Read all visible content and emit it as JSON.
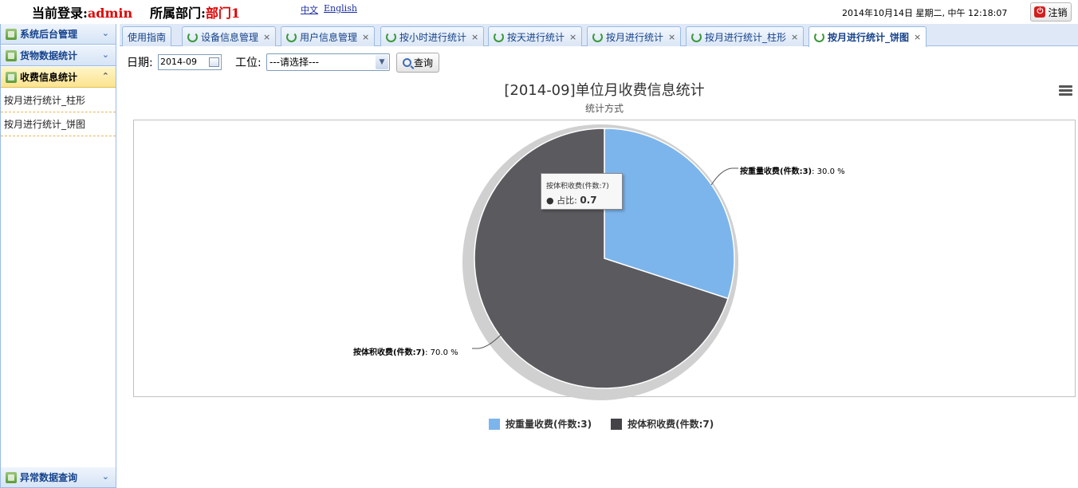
{
  "header": {
    "login_label": "当前登录:",
    "login_user": "admin",
    "dept_label": "所属部门:",
    "dept_value": "部门1",
    "lang_zh": "中文",
    "lang_en": "English",
    "datetime": "2014年10月14日 星期二, 中午 12:18:07",
    "logout_label": "注销"
  },
  "sidebar": {
    "sections": [
      {
        "label": "系统后台管理"
      },
      {
        "label": "货物数据统计"
      },
      {
        "label": "收费信息统计"
      },
      {
        "label": "异常数据查询"
      }
    ],
    "sub_items": [
      {
        "label": "按月进行统计_柱形"
      },
      {
        "label": "按月进行统计_饼图"
      }
    ]
  },
  "tabs": [
    {
      "label": "使用指南"
    },
    {
      "label": "设备信息管理"
    },
    {
      "label": "用户信息管理"
    },
    {
      "label": "按小时进行统计"
    },
    {
      "label": "按天进行统计"
    },
    {
      "label": "按月进行统计"
    },
    {
      "label": "按月进行统计_柱形"
    },
    {
      "label": "按月进行统计_饼图"
    }
  ],
  "toolbar": {
    "date_label": "日期:",
    "date_value": "2014-09",
    "station_label": "工位:",
    "station_value": "---请选择---",
    "query_label": "查询"
  },
  "colors": {
    "series_1": "#7cb5ec",
    "series_2": "#5a5a5f",
    "legend_2": "#434348"
  },
  "chart_data": {
    "type": "pie",
    "title": "[2014-09]单位月收费信息统计",
    "subtitle": "统计方式",
    "series": [
      {
        "name": "按重量收费(件数:3)",
        "value": 3,
        "percent": "30.0 %"
      },
      {
        "name": "按体积收费(件数:7)",
        "value": 7,
        "percent": "70.0 %"
      }
    ],
    "tooltip": {
      "series_name": "按体积收费(件数:7)",
      "label": "占比:",
      "value": "0.7"
    }
  }
}
